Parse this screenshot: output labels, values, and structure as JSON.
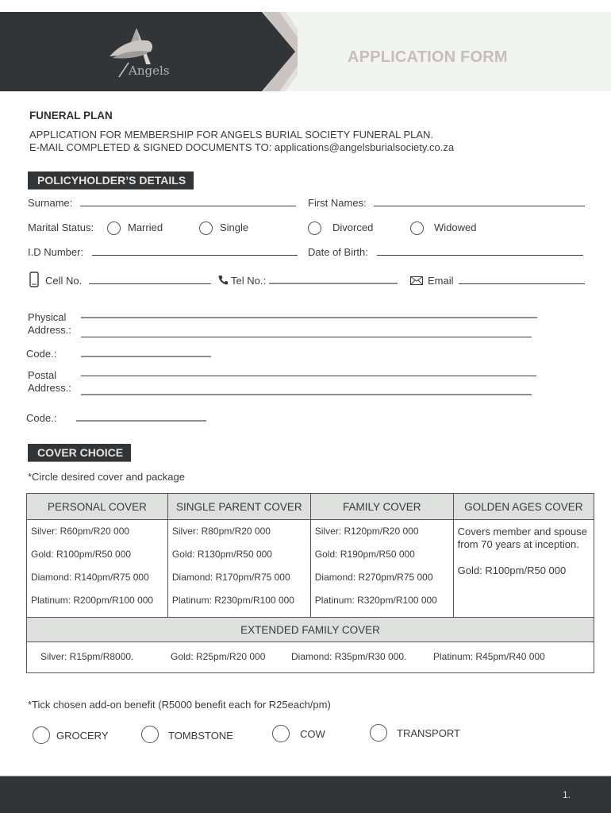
{
  "header": {
    "logo_text": "Angels",
    "title": "APPLICATION FORM"
  },
  "intro": {
    "plan_heading": "FUNERAL PLAN",
    "line1": "APPLICATION FOR MEMBERSHIP FOR ANGELS BURIAL SOCIETY FUNERAL PLAN.",
    "line2": "E-MAIL COMPLETED & SIGNED DOCUMENTS TO: applications@angelsburialsociety.co.za"
  },
  "policyholder": {
    "section_title": "POLICYHOLDER’S DETAILS",
    "surname_label": "Surname:",
    "first_names_label": "First Names:",
    "marital_status_label": "Marital Status:",
    "marital_options": [
      "Married",
      "Single",
      "Divorced",
      "Widowed"
    ],
    "id_number_label": "I.D Number:",
    "dob_label": "Date of Birth:",
    "cell_label": "Cell No.",
    "tel_label": "Tel No.:",
    "email_label": "Email",
    "physical_address_label_1": "Physical",
    "physical_address_label_2": "Address.:",
    "code_label": "Code.:",
    "postal_address_label_1": "Postal",
    "postal_address_label_2": "Address.:",
    "postal_code_label": "Code.:"
  },
  "cover_choice": {
    "section_title": "COVER CHOICE",
    "instruction": "*Circle desired cover and package",
    "columns": [
      {
        "header": "PERSONAL COVER",
        "options": [
          "Silver: R60pm/R20 000",
          "Gold: R100pm/R50 000",
          "Diamond: R140pm/R75 000",
          "Platinum: R200pm/R100 000"
        ]
      },
      {
        "header": "SINGLE PARENT COVER",
        "options": [
          "Silver: R80pm/R20 000",
          "Gold: R130pm/R50 000",
          "Diamond: R170pm/R75 000",
          "Platinum: R230pm/R100 000"
        ]
      },
      {
        "header": "FAMILY COVER",
        "options": [
          "Silver: R120pm/R20 000",
          "Gold: R190pm/R50 000",
          "Diamond: R270pm/R75 000",
          "Platinum: R320pm/R100 000"
        ]
      },
      {
        "header": "GOLDEN AGES COVER",
        "description": "Covers member and spouse from 70 years at inception.",
        "options": [
          "Gold: R100pm/R50 000"
        ]
      }
    ],
    "extended": {
      "header": "EXTENDED FAMILY COVER",
      "options": [
        "Silver: R15pm/R8000.",
        "Gold: R25pm/R20 000",
        "Diamond: R35pm/R30 000.",
        "Platinum: R45pm/R40 000"
      ]
    }
  },
  "addons": {
    "instruction": "*Tick chosen add-on benefit  (R5000 benefit each for R25each/pm)",
    "options": [
      "GROCERY",
      "TOMBSTONE",
      "COW",
      "TRANSPORT"
    ]
  },
  "footer": {
    "page_number": "1."
  },
  "colors": {
    "dark": "#323538",
    "banner_light": "#f2f4f1",
    "title_text": "#c8beb9",
    "table_header": "#dde0dc"
  }
}
